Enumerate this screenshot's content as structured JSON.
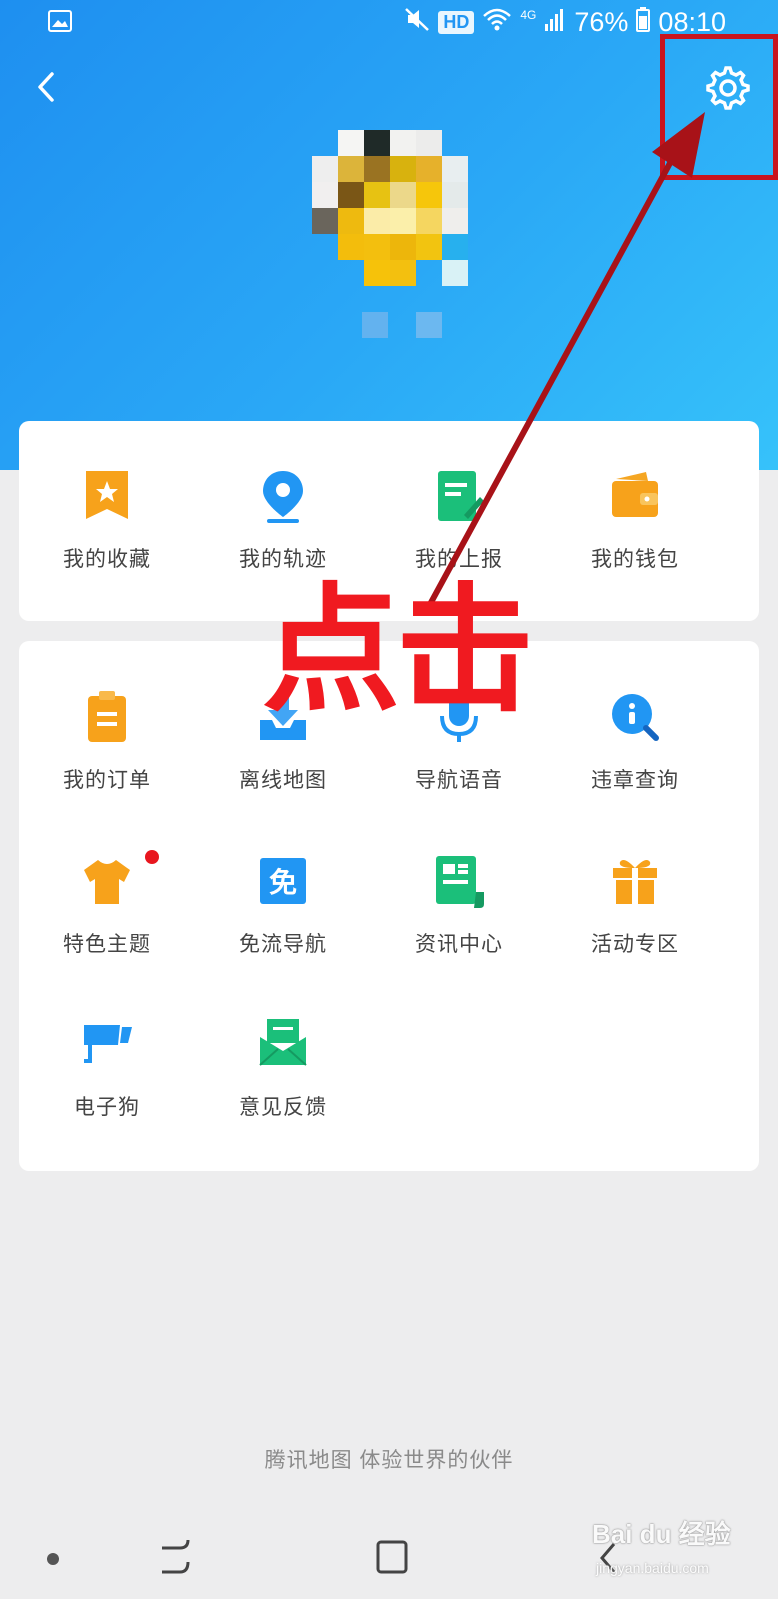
{
  "status_bar": {
    "hd": "HD",
    "network": "4G",
    "battery": "76%",
    "time": "08:10"
  },
  "header": {
    "back_icon": "chevron-left-icon",
    "settings_icon": "gear-icon"
  },
  "shortcuts": [
    {
      "label": "我的收藏",
      "icon": "bookmark-star-icon",
      "color": "#f7a21b"
    },
    {
      "label": "我的轨迹",
      "icon": "location-pin-icon",
      "color": "#2196f3"
    },
    {
      "label": "我的上报",
      "icon": "report-edit-icon",
      "color": "#1bbf7a"
    },
    {
      "label": "我的钱包",
      "icon": "wallet-icon",
      "color": "#f7a21b"
    }
  ],
  "services": [
    {
      "label": "我的订单",
      "icon": "clipboard-icon",
      "color": "#f7a21b",
      "badge": false
    },
    {
      "label": "离线地图",
      "icon": "download-tray-icon",
      "color": "#2196f3",
      "badge": false
    },
    {
      "label": "导航语音",
      "icon": "microphone-icon",
      "color": "#2196f3",
      "badge": false
    },
    {
      "label": "违章查询",
      "icon": "search-info-icon",
      "color": "#2196f3",
      "badge": false
    },
    {
      "label": "特色主题",
      "icon": "tshirt-icon",
      "color": "#f7a21b",
      "badge": true
    },
    {
      "label": "免流导航",
      "icon": "free-data-icon",
      "color": "#2196f3",
      "badge": false
    },
    {
      "label": "资讯中心",
      "icon": "news-icon",
      "color": "#1bbf7a",
      "badge": false
    },
    {
      "label": "活动专区",
      "icon": "gift-icon",
      "color": "#f7a21b",
      "badge": false
    },
    {
      "label": "电子狗",
      "icon": "speed-camera-icon",
      "color": "#2196f3",
      "badge": false
    },
    {
      "label": "意见反馈",
      "icon": "feedback-envelope-icon",
      "color": "#1bbf7a",
      "badge": false
    }
  ],
  "footer": {
    "slogan": "腾讯地图  体验世界的伙伴"
  },
  "annotation": {
    "text": "点击",
    "color": "#f01a20"
  },
  "watermark": {
    "brand": "Bai du 经验",
    "url": "jingyan.baidu.com"
  }
}
